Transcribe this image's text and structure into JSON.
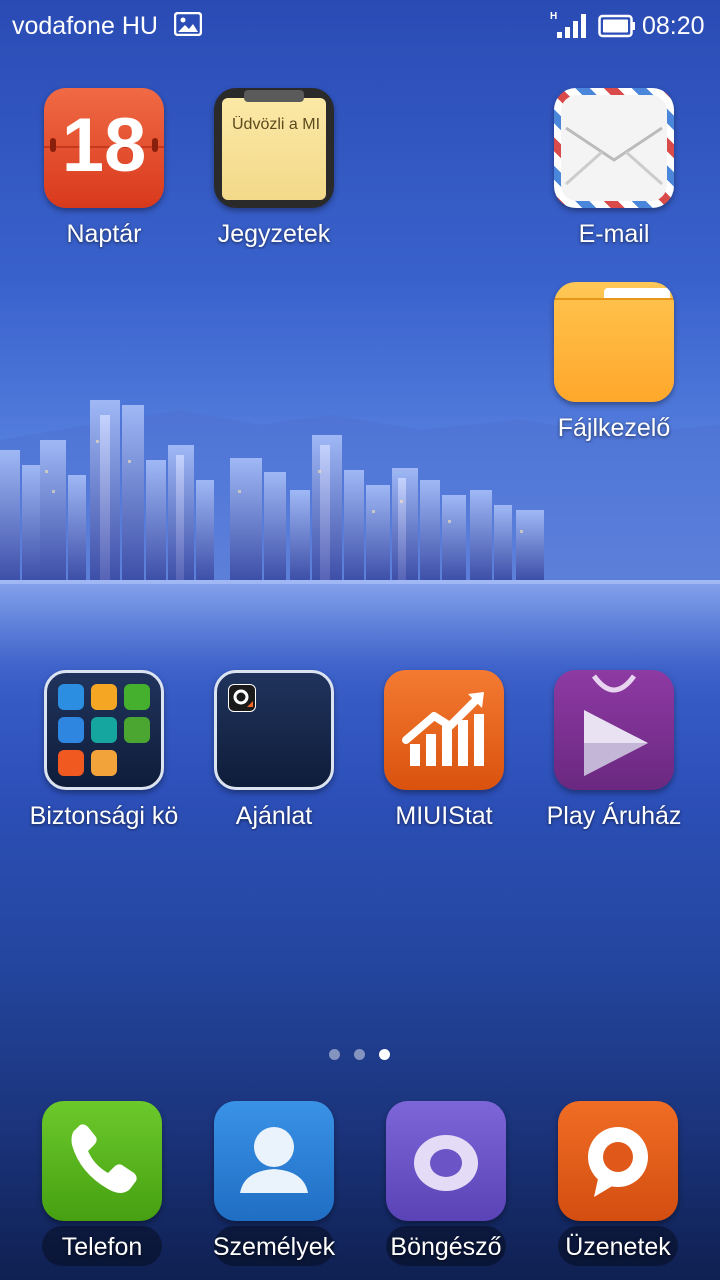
{
  "status_bar": {
    "carrier": "vodafone HU",
    "network_type": "H",
    "time": "08:20"
  },
  "calendar": {
    "date_number": "18"
  },
  "notes": {
    "preview_text": "Üdvözli a MI"
  },
  "apps": {
    "naptar": "Naptár",
    "jegyzetek": "Jegyzetek",
    "email": "E-mail",
    "fajlkezelo": "Fájlkezelő",
    "biztonsagi": "Biztonsági kö",
    "ajanlat": "Ajánlat",
    "miuistat": "MIUIStat",
    "play": "Play Áruház"
  },
  "dock": {
    "telefon": "Telefon",
    "szemelyek": "Személyek",
    "bongeszo": "Böngésző",
    "uzenetek": "Üzenetek"
  },
  "page_indicator": {
    "count": 3,
    "active_index": 2
  },
  "colors": {
    "calendar_red": "#e8492e",
    "email_white": "#f4f4f4",
    "folder_orange": "#ffb53d",
    "miuistat_orange": "#e8661d",
    "play_purple": "#7b2f8f",
    "phone_green": "#5bb519",
    "contacts_blue": "#2a7fd8",
    "browser_purple": "#6d57c9",
    "messages_orange": "#e65d1a"
  }
}
